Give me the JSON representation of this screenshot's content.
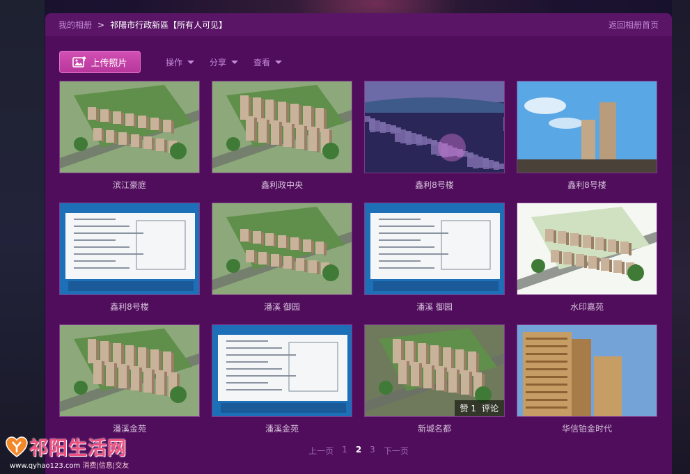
{
  "breadcrumb": {
    "root": "我的相册",
    "separator": ">",
    "current": "祁陽市行政新區【所有人可见】",
    "back": "返回相册首页"
  },
  "toolbar": {
    "upload": "上传照片",
    "menus": [
      "操作",
      "分享",
      "查看"
    ]
  },
  "photos": [
    {
      "caption": "滨江豪庭",
      "theme": "aerial-green"
    },
    {
      "caption": "鑫利政中央",
      "theme": "aerial-towers"
    },
    {
      "caption": "鑫利8号楼",
      "theme": "night-city"
    },
    {
      "caption": "鑫利8号楼",
      "theme": "sky-tower"
    },
    {
      "caption": "鑫利8号楼",
      "theme": "notice-board"
    },
    {
      "caption": "潘溪 御园",
      "theme": "aerial-green"
    },
    {
      "caption": "潘溪 御园",
      "theme": "notice-board"
    },
    {
      "caption": "水印嘉苑",
      "theme": "aerial-white"
    },
    {
      "caption": "潘溪金苑",
      "theme": "aerial-towers"
    },
    {
      "caption": "潘溪金苑",
      "theme": "notice-board"
    },
    {
      "caption": "新城名都",
      "theme": "aerial-city"
    },
    {
      "caption": "华信铂金时代",
      "theme": "sky-gold"
    }
  ],
  "badge": {
    "index": 10,
    "likes": "赞 1",
    "comments": "评论"
  },
  "pager": {
    "prev": "上一页",
    "pages": [
      "1",
      "2",
      "3"
    ],
    "current": "2",
    "next": "下一页"
  },
  "logo": {
    "title": "祁阳生活网",
    "url": "www.qyhao123.com",
    "tags": "消费|信息|交友"
  },
  "colors": {
    "panel": "#4f0d5b",
    "accent": "#c48ad8",
    "upload": "#c23fa4"
  }
}
